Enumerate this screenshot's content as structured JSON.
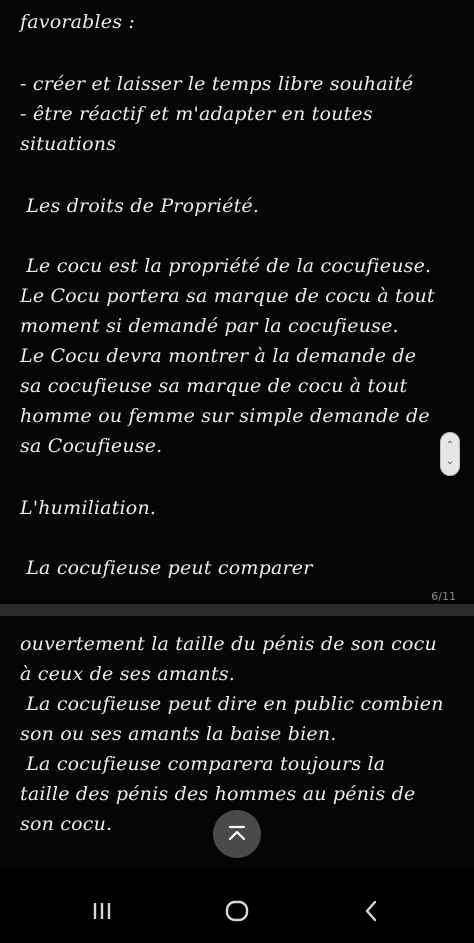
{
  "document": {
    "page_indicator": "6/11",
    "page1_lines": [
      "favorables :",
      "",
      "- créer et laisser le temps libre souhaité",
      "- être réactif et m'adapter en toutes",
      "situations",
      "",
      " Les droits de Propriété.",
      "",
      " Le cocu est la propriété de la cocufieuse.",
      "Le Cocu portera sa marque de cocu à tout",
      "moment si demandé par la cocufieuse.",
      "Le Cocu devra montrer à la demande de",
      "sa cocufieuse sa marque de cocu à tout",
      "homme ou femme sur simple demande de",
      "sa Cocufieuse.",
      "",
      "L'humiliation.",
      "",
      " La cocufieuse peut comparer"
    ],
    "page2_lines": [
      "ouvertement la taille du pénis de son cocu",
      "à ceux de ses amants.",
      " La cocufieuse peut dire en public combien",
      "son ou ses amants la baise bien.",
      " La cocufieuse comparera toujours la",
      "taille des pénis des hommes au pénis de",
      "son cocu."
    ]
  },
  "controls": {
    "fast_scroll_up_icon": "chevron-up-icon",
    "fast_scroll_down_icon": "chevron-down-icon",
    "scroll_top_icon": "arrow-up-to-top-icon"
  },
  "navigation": {
    "recents_icon": "recents-icon",
    "home_icon": "home-icon",
    "back_icon": "back-icon"
  },
  "colors": {
    "background": "#000000",
    "text": "#ededed",
    "separator": "#2b2b2b",
    "button": "#4a4a4a"
  }
}
